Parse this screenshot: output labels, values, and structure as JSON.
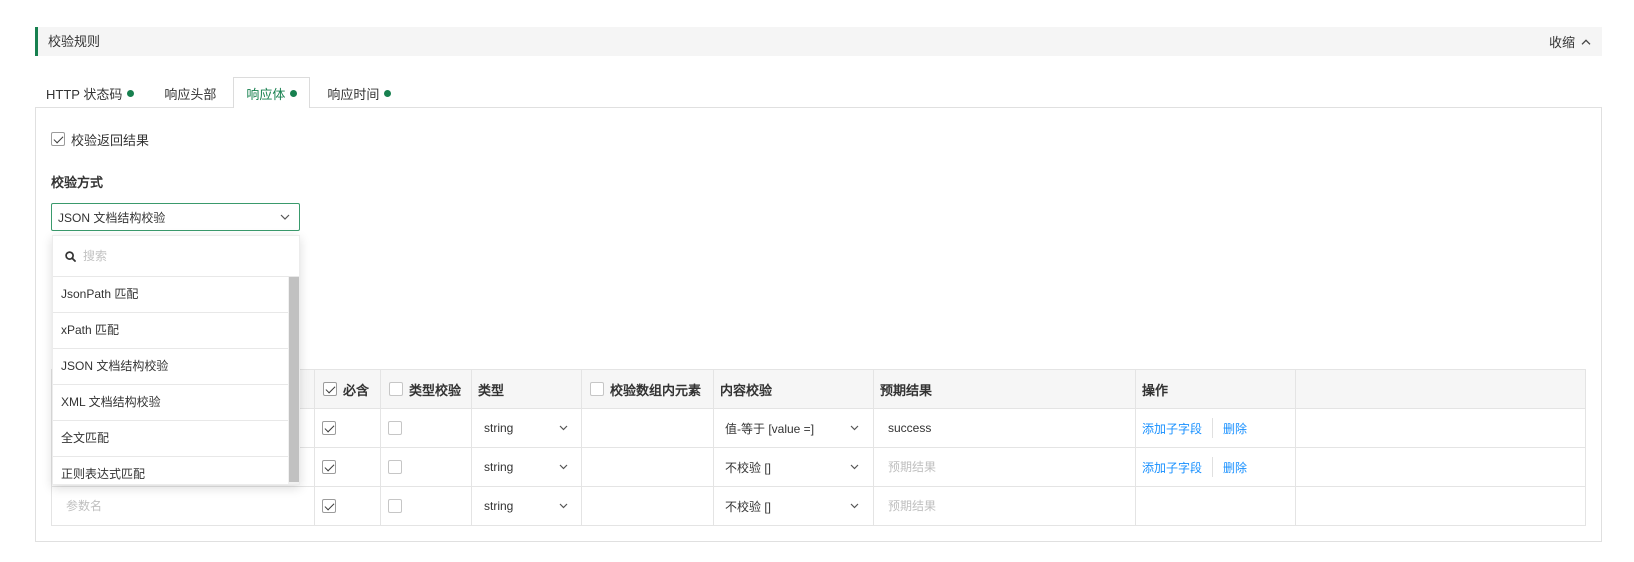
{
  "section": {
    "title": "校验规则",
    "collapse_label": "收缩"
  },
  "tabs": [
    {
      "label": "HTTP 状态码",
      "status_dot": true,
      "active": false
    },
    {
      "label": "响应头部",
      "status_dot": false,
      "active": false
    },
    {
      "label": "响应体",
      "status_dot": true,
      "active": true
    },
    {
      "label": "响应时间",
      "status_dot": true,
      "active": false
    }
  ],
  "validation": {
    "check_response": {
      "label": "校验返回结果",
      "checked": true
    },
    "method": {
      "label": "校验方式",
      "value": "JSON 文档结构校验",
      "dropdown_open": true,
      "search_placeholder": "搜索",
      "options": [
        "JsonPath 匹配",
        "xPath 匹配",
        "JSON 文档结构校验",
        "XML 文档结构校验",
        "全文匹配",
        "正则表达式匹配"
      ]
    }
  },
  "table": {
    "columns": {
      "required": "必含",
      "type_check": "类型校验",
      "type": "类型",
      "array_elements": "校验数组内元素",
      "content_check": "内容校验",
      "expected": "预期结果",
      "actions": "操作"
    },
    "header_checks": {
      "required": true,
      "type_check": false,
      "array_elements": false
    },
    "rows": [
      {
        "required": true,
        "type_check": false,
        "type": "string",
        "content_check": "值-等于 [value =]",
        "expected": "success",
        "actions": {
          "add_child": "添加子字段",
          "delete": "删除"
        }
      },
      {
        "required": true,
        "type_check": false,
        "type": "string",
        "content_check": "不校验 []",
        "expected_placeholder": "预期结果",
        "actions": {
          "add_child": "添加子字段",
          "delete": "删除"
        }
      },
      {
        "name_placeholder": "参数名",
        "required": true,
        "type_check": false,
        "type": "string",
        "content_check": "不校验 []",
        "expected_placeholder": "预期结果"
      }
    ]
  },
  "icons": {
    "collapse": "chevron-up-icon",
    "select": "chevron-down-icon",
    "search": "search-icon",
    "tab_status": "status-dot-icon"
  },
  "colors": {
    "accent": "#17804f",
    "link": "#1890ff",
    "bar_bg": "#f5f5f5",
    "border": "#e4e4e4",
    "placeholder": "#bfbfbf"
  }
}
